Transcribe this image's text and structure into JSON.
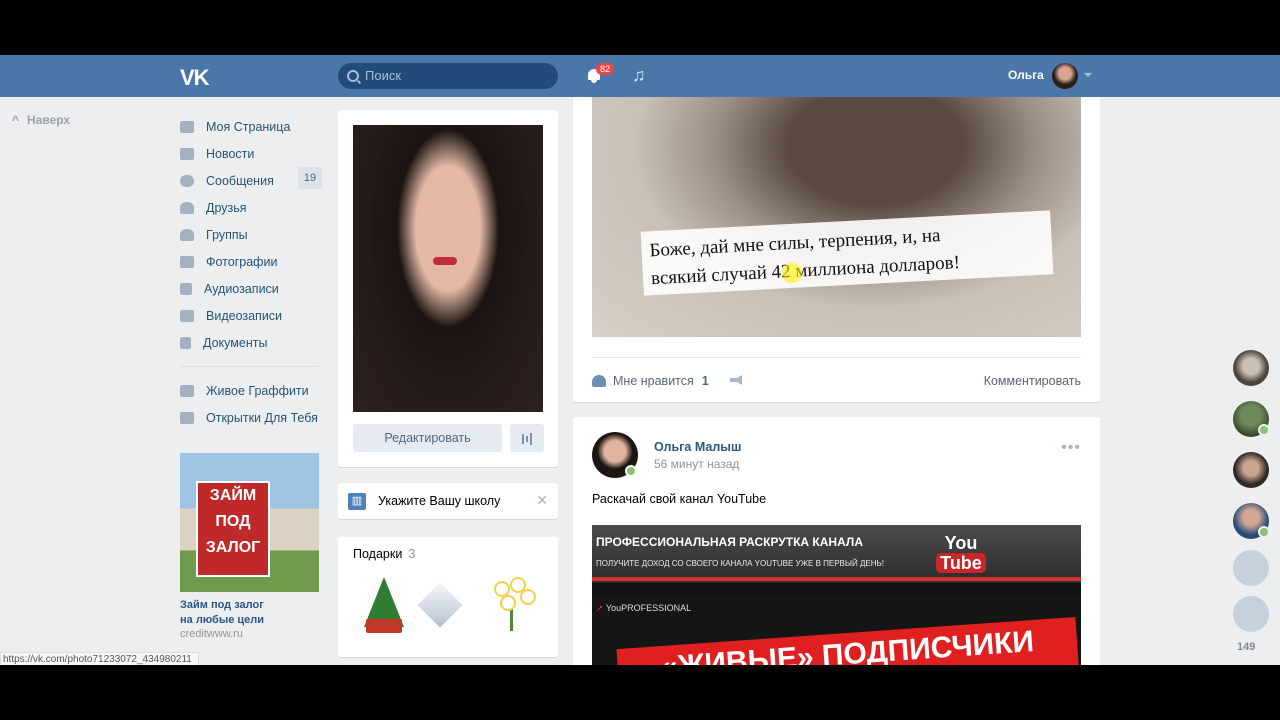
{
  "header": {
    "search_placeholder": "Поиск",
    "notifications_count": "82",
    "user_name": "Ольга",
    "brand_color": "#4a76a8"
  },
  "back_to_top": "Наверх",
  "sidebar": {
    "items": [
      {
        "label": "Моя Страница",
        "icon": "home-icon"
      },
      {
        "label": "Новости",
        "icon": "news-icon"
      },
      {
        "label": "Сообщения",
        "icon": "messages-icon",
        "count": "19"
      },
      {
        "label": "Друзья",
        "icon": "friends-icon"
      },
      {
        "label": "Группы",
        "icon": "groups-icon"
      },
      {
        "label": "Фотографии",
        "icon": "camera-icon"
      },
      {
        "label": "Аудиозаписи",
        "icon": "music-icon"
      },
      {
        "label": "Видеозаписи",
        "icon": "video-icon"
      },
      {
        "label": "Документы",
        "icon": "document-icon"
      }
    ],
    "apps": [
      {
        "label": "Живое Граффити",
        "icon": "app-grid-icon"
      },
      {
        "label": "Открытки Для Тебя",
        "icon": "app-grid-icon"
      }
    ]
  },
  "ad": {
    "sign_line1": "ЗАЙМ",
    "sign_line2": "ПОД",
    "sign_line3": "ЗАЛОГ",
    "title_line1": "Займ под залог",
    "title_line2": "на любые цели",
    "domain": "creditwww.ru"
  },
  "profile": {
    "edit_label": "Редактировать"
  },
  "school_prompt": "Укажите Вашу школу",
  "gifts": {
    "title": "Подарки",
    "count": "3"
  },
  "post1": {
    "caption_line1": "Боже, дай мне силы, терпения, и, на",
    "caption_line2": "всякий случай 42 миллиона долларов!",
    "like_label": "Мне нравится",
    "like_count": "1",
    "comment_label": "Комментировать"
  },
  "post2": {
    "author": "Ольга Малыш",
    "time": "56 минут назад",
    "text": "Раскачай свой канал YouTube",
    "banner_heading": "ПРОФЕССИОНАЛЬНАЯ РАСКРУТКА КАНАЛА",
    "banner_sub": "ПОЛУЧИТЕ ДОХОД СО СВОЕГО КАНАЛА YOUTUBE УЖЕ В ПЕРВЫЙ ДЕНЬ!",
    "yt_you": "You",
    "yt_tube": "Tube",
    "brand": "YouPROFESSIONAL",
    "big_text": "«ЖИВЫЕ» ПОДПИСЧИКИ"
  },
  "friends_online": {
    "count": "149"
  },
  "status_url": "https://vk.com/photo71233072_434980211"
}
